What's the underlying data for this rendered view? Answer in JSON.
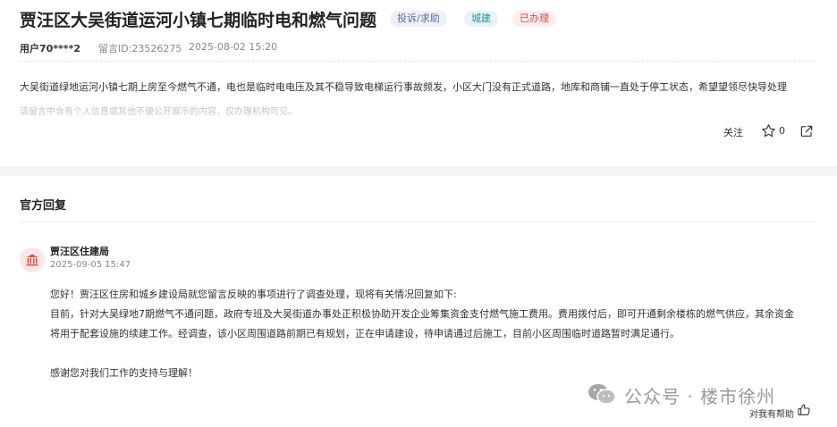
{
  "question": {
    "title": "贾汪区大吴街道运河小镇七期临时电和燃气问题",
    "tags": {
      "type": "投诉/求助",
      "category": "城建",
      "status": "已办理"
    },
    "user": "用户70****2",
    "message_id": "留言ID:23526275",
    "time": "2025-08-02 15:20",
    "content": "大吴街道绿地运河小镇七期上房至今燃气不通，电也是临时电电压及其不稳导致电梯运行事故频发，小区大门没有正式道路，地库和商铺一直处于停工状态，希望望领尽快导处理",
    "notice": "该留言中含有个人信息或其他不便公开展示的内容，仅办理机构可见。",
    "actions": {
      "follow_label": "关注",
      "like_count": "0"
    }
  },
  "reply": {
    "section_title": "官方回复",
    "org": "贾汪区住建局",
    "time": "2025-09-05 15:47",
    "lines": [
      "您好！贾汪区住房和城乡建设局就您留言反映的事项进行了调查处理，现将有关情况回复如下:",
      "目前，针对大吴绿地7期燃气不通问题，政府专班及大吴街道办事处正积极协助开发企业筹集资金支付燃气施工费用。费用拨付后，即可开通剩余楼栋的燃气供应，其余资金",
      "将用于配套设施的续建工作。经调查，该小区周围道路前期已有规划，正在申请建设，待申请通过后施工，目前小区周围临时道路暂时满足通行。",
      "感谢您对我们工作的支持与理解！"
    ],
    "helpful_label": "对我有帮助"
  },
  "watermark": {
    "text": "公众号 · 楼市徐州"
  },
  "colors": {
    "status_red": "#e0474c",
    "category_teal": "#2a8f9e",
    "type_blue": "#5b6e99",
    "org_icon_red": "#d9534f"
  }
}
